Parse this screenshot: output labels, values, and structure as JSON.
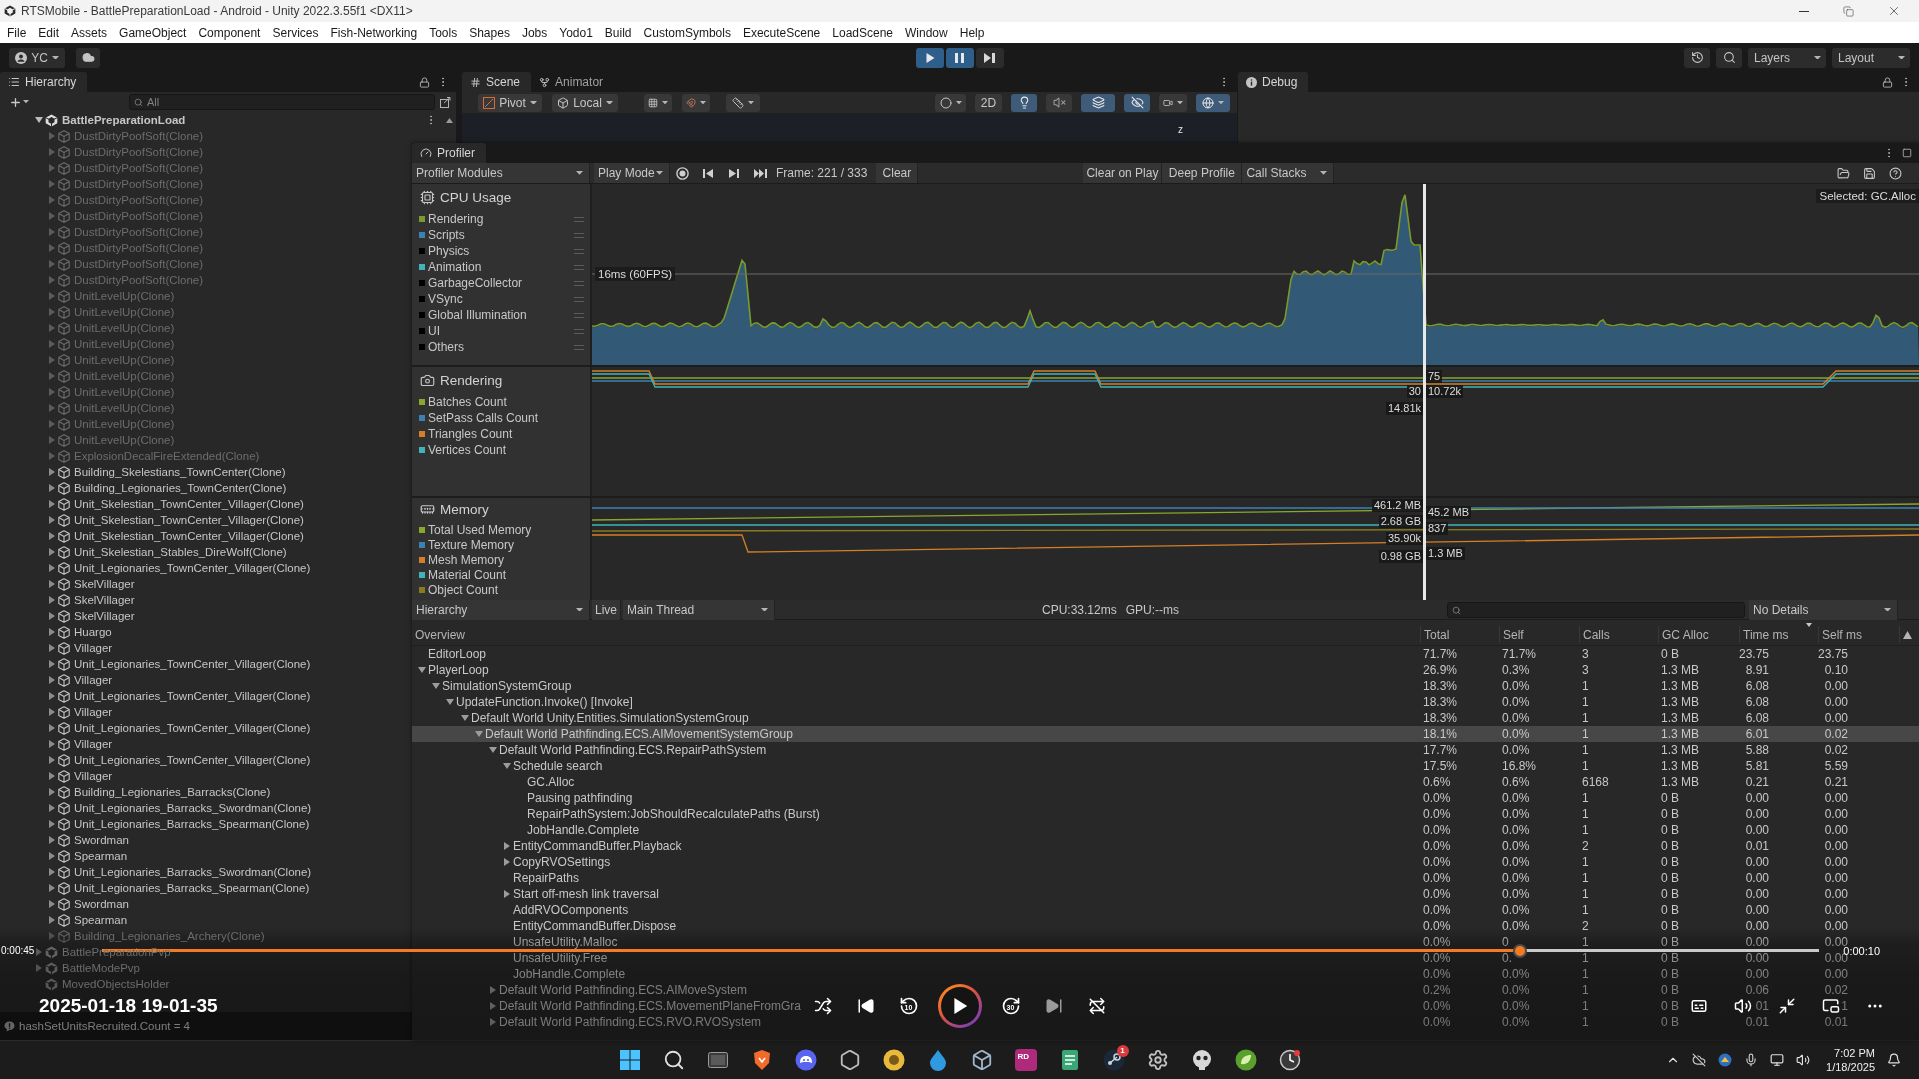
{
  "window": {
    "title": "RTSMobile - BattlePreparationLoad - Android - Unity 2022.3.55f1 <DX11>"
  },
  "menu": [
    "File",
    "Edit",
    "Assets",
    "GameObject",
    "Component",
    "Services",
    "Fish-Networking",
    "Tools",
    "Shapes",
    "Jobs",
    "Yodo1",
    "Build",
    "CustomSymbols",
    "ExecuteScene",
    "LoadScene",
    "Window",
    "Help"
  ],
  "toolbar": {
    "account": "YC",
    "play_controls": [
      {
        "kind": "play",
        "on": true
      },
      {
        "kind": "pause",
        "on": true
      },
      {
        "kind": "step",
        "on": false
      }
    ],
    "layers": "Layers",
    "layout": "Layout"
  },
  "hierarchy": {
    "tab": "Hierarchy",
    "search": {
      "placeholder": "All"
    },
    "scenes": [
      {
        "name": "BattlePreparationLoad",
        "loaded": true,
        "expanded": true,
        "children": [
          {
            "name": "DustDirtyPoofSoft(Clone)",
            "active": false,
            "expanded": false
          },
          {
            "name": "DustDirtyPoofSoft(Clone)",
            "active": false,
            "expanded": false
          },
          {
            "name": "DustDirtyPoofSoft(Clone)",
            "active": false,
            "expanded": false
          },
          {
            "name": "DustDirtyPoofSoft(Clone)",
            "active": false,
            "expanded": false
          },
          {
            "name": "DustDirtyPoofSoft(Clone)",
            "active": false,
            "expanded": false
          },
          {
            "name": "DustDirtyPoofSoft(Clone)",
            "active": false,
            "expanded": false
          },
          {
            "name": "DustDirtyPoofSoft(Clone)",
            "active": false,
            "expanded": false
          },
          {
            "name": "DustDirtyPoofSoft(Clone)",
            "active": false,
            "expanded": false
          },
          {
            "name": "DustDirtyPoofSoft(Clone)",
            "active": false,
            "expanded": false
          },
          {
            "name": "DustDirtyPoofSoft(Clone)",
            "active": false,
            "expanded": false
          },
          {
            "name": "UnitLevelUp(Clone)",
            "active": false,
            "expanded": false
          },
          {
            "name": "UnitLevelUp(Clone)",
            "active": false,
            "expanded": false
          },
          {
            "name": "UnitLevelUp(Clone)",
            "active": false,
            "expanded": false
          },
          {
            "name": "UnitLevelUp(Clone)",
            "active": false,
            "expanded": false
          },
          {
            "name": "UnitLevelUp(Clone)",
            "active": false,
            "expanded": false
          },
          {
            "name": "UnitLevelUp(Clone)",
            "active": false,
            "expanded": false
          },
          {
            "name": "UnitLevelUp(Clone)",
            "active": false,
            "expanded": false
          },
          {
            "name": "UnitLevelUp(Clone)",
            "active": false,
            "expanded": false
          },
          {
            "name": "UnitLevelUp(Clone)",
            "active": false,
            "expanded": false
          },
          {
            "name": "UnitLevelUp(Clone)",
            "active": false,
            "expanded": false
          },
          {
            "name": "ExplosionDecalFireExtended(Clone)",
            "active": false,
            "expanded": false
          },
          {
            "name": "Building_Skelestians_TownCenter(Clone)",
            "active": true,
            "expanded": false
          },
          {
            "name": "Building_Legionaries_TownCenter(Clone)",
            "active": true,
            "expanded": false
          },
          {
            "name": "Unit_Skelestian_TownCenter_Villager(Clone)",
            "active": true,
            "expanded": false
          },
          {
            "name": "Unit_Skelestian_TownCenter_Villager(Clone)",
            "active": true,
            "expanded": false
          },
          {
            "name": "Unit_Skelestian_TownCenter_Villager(Clone)",
            "active": true,
            "expanded": false
          },
          {
            "name": "Unit_Skelestian_Stables_DireWolf(Clone)",
            "active": true,
            "expanded": false
          },
          {
            "name": "Unit_Legionaries_TownCenter_Villager(Clone)",
            "active": true,
            "expanded": false
          },
          {
            "name": "SkelVillager",
            "active": true,
            "expanded": false
          },
          {
            "name": "SkelVillager",
            "active": true,
            "expanded": false
          },
          {
            "name": "SkelVillager",
            "active": true,
            "expanded": false
          },
          {
            "name": "Huargo",
            "active": true,
            "expanded": false
          },
          {
            "name": "Villager",
            "active": true,
            "expanded": false
          },
          {
            "name": "Unit_Legionaries_TownCenter_Villager(Clone)",
            "active": true,
            "expanded": false
          },
          {
            "name": "Villager",
            "active": true,
            "expanded": false
          },
          {
            "name": "Unit_Legionaries_TownCenter_Villager(Clone)",
            "active": true,
            "expanded": false
          },
          {
            "name": "Villager",
            "active": true,
            "expanded": false
          },
          {
            "name": "Unit_Legionaries_TownCenter_Villager(Clone)",
            "active": true,
            "expanded": false
          },
          {
            "name": "Villager",
            "active": true,
            "expanded": false
          },
          {
            "name": "Unit_Legionaries_TownCenter_Villager(Clone)",
            "active": true,
            "expanded": false
          },
          {
            "name": "Villager",
            "active": true,
            "expanded": false
          },
          {
            "name": "Building_Legionaries_Barracks(Clone)",
            "active": true,
            "expanded": false
          },
          {
            "name": "Unit_Legionaries_Barracks_Swordman(Clone)",
            "active": true,
            "expanded": false
          },
          {
            "name": "Unit_Legionaries_Barracks_Spearman(Clone)",
            "active": true,
            "expanded": false
          },
          {
            "name": "Swordman",
            "active": true,
            "expanded": false
          },
          {
            "name": "Spearman",
            "active": true,
            "expanded": false
          },
          {
            "name": "Unit_Legionaries_Barracks_Swordman(Clone)",
            "active": true,
            "expanded": false
          },
          {
            "name": "Unit_Legionaries_Barracks_Spearman(Clone)",
            "active": true,
            "expanded": false
          },
          {
            "name": "Swordman",
            "active": true,
            "expanded": false
          },
          {
            "name": "Spearman",
            "active": true,
            "expanded": false
          },
          {
            "name": "Building_Legionaries_Archery(Clone)",
            "active": false,
            "expanded": false
          }
        ]
      },
      {
        "name": "BattlePreparationPvp",
        "loaded": false,
        "expanded": false
      },
      {
        "name": "BattleModePvp",
        "loaded": false,
        "expanded": false
      },
      {
        "name": "MovedObjectsHolder",
        "loaded": false
      }
    ]
  },
  "scene_panel": {
    "tabs": [
      {
        "label": "Scene",
        "selected": true
      },
      {
        "label": "Animator",
        "selected": false
      }
    ],
    "pivot": "Pivot",
    "space": "Local",
    "toggle_2d": {
      "label": "2D",
      "on": false
    },
    "toggles": [
      {
        "kind": "lighting",
        "on": true
      },
      {
        "kind": "audio",
        "on": false
      },
      {
        "kind": "effects",
        "on": true
      },
      {
        "kind": "visibility",
        "on": true
      }
    ],
    "gizmo_axis": "z"
  },
  "debug_panel": {
    "tab": "Debug"
  },
  "profiler": {
    "tab": "Profiler",
    "toolbar": {
      "modules": "Profiler Modules",
      "play_mode": "Play Mode",
      "recording": false,
      "frame": "Frame: 221 / 333",
      "clear": "Clear",
      "clear_on_play": {
        "label": "Clear on Play",
        "on": false
      },
      "deep_profile": {
        "label": "Deep Profile",
        "on": false
      },
      "call_stacks": "Call Stacks"
    },
    "selected_sample": "Selected: GC.Alloc",
    "modules": [
      {
        "kind": "cpu",
        "title": "CPU Usage",
        "target_line": "16ms (60FPS)",
        "legend": [
          {
            "label": "Rendering",
            "color": "#7a9a2e"
          },
          {
            "label": "Scripts",
            "color": "#3b82b4"
          },
          {
            "label": "Physics",
            "color": "#000000"
          },
          {
            "label": "Animation",
            "color": "#3eb4b9"
          },
          {
            "label": "GarbageCollector",
            "color": "#000000"
          },
          {
            "label": "VSync",
            "color": "#000000"
          },
          {
            "label": "Global Illumination",
            "color": "#000000"
          },
          {
            "label": "UI",
            "color": "#000000"
          },
          {
            "label": "Others",
            "color": "#000000"
          }
        ]
      },
      {
        "kind": "rendering",
        "title": "Rendering",
        "readouts": [
          "75",
          "30",
          "10.72k",
          "14.81k"
        ],
        "legend": [
          {
            "label": "Batches Count",
            "color": "#8aa62d"
          },
          {
            "label": "SetPass Calls Count",
            "color": "#3b82b4"
          },
          {
            "label": "Triangles Count",
            "color": "#d47f25"
          },
          {
            "label": "Vertices Count",
            "color": "#3eb4b9"
          }
        ]
      },
      {
        "kind": "memory",
        "title": "Memory",
        "readouts": [
          "461.2 MB",
          "45.2 MB",
          "2.68 GB",
          "837",
          "35.90k",
          "0.98 GB",
          "1.3 MB"
        ],
        "legend": [
          {
            "label": "Total Used Memory",
            "color": "#8aa62d"
          },
          {
            "label": "Texture Memory",
            "color": "#3b82b4"
          },
          {
            "label": "Mesh Memory",
            "color": "#d47f25"
          },
          {
            "label": "Material Count",
            "color": "#3eb4b9"
          },
          {
            "label": "Object Count",
            "color": "#8a7a1e"
          }
        ]
      }
    ],
    "details": {
      "view": "Hierarchy",
      "live": {
        "label": "Live",
        "on": false
      },
      "thread": "Main Thread",
      "cpu_time": "CPU:33.12ms",
      "gpu_time": "GPU:--ms",
      "detail_view": "No Details"
    },
    "table": {
      "columns": [
        {
          "label": "Overview",
          "sorted": false
        },
        {
          "label": "Total",
          "sorted": false
        },
        {
          "label": "Self",
          "sorted": false
        },
        {
          "label": "Calls",
          "sorted": false
        },
        {
          "label": "GC Alloc",
          "sorted": false
        },
        {
          "label": "Time ms",
          "sorted": true
        },
        {
          "label": "Self ms",
          "sorted": false
        }
      ],
      "rows": [
        {
          "cells": [
            "EditorLoop",
            "71.7%",
            "71.7%",
            "3",
            "0 B",
            "23.75",
            "23.75"
          ],
          "selected": false
        },
        {
          "cells": [
            "PlayerLoop",
            "26.9%",
            "0.3%",
            "3",
            "1.3 MB",
            "8.91",
            "0.10"
          ],
          "selected": false,
          "expanded": true,
          "children": [
            {
              "cells": [
                "SimulationSystemGroup",
                "18.3%",
                "0.0%",
                "1",
                "1.3 MB",
                "6.08",
                "0.00"
              ],
              "selected": false,
              "expanded": true,
              "children": [
                {
                  "cells": [
                    "UpdateFunction.Invoke() [Invoke]",
                    "18.3%",
                    "0.0%",
                    "1",
                    "1.3 MB",
                    "6.08",
                    "0.00"
                  ],
                  "selected": false,
                  "expanded": true,
                  "children": [
                    {
                      "cells": [
                        "Default World Unity.Entities.SimulationSystemGroup",
                        "18.3%",
                        "0.0%",
                        "1",
                        "1.3 MB",
                        "6.08",
                        "0.00"
                      ],
                      "selected": false,
                      "expanded": true,
                      "children": [
                        {
                          "cells": [
                            "Default World Pathfinding.ECS.AIMovementSystemGroup",
                            "18.1%",
                            "0.0%",
                            "1",
                            "1.3 MB",
                            "6.01",
                            "0.02"
                          ],
                          "selected": true,
                          "expanded": true,
                          "children": [
                            {
                              "cells": [
                                "Default World Pathfinding.ECS.RepairPathSystem",
                                "17.7%",
                                "0.0%",
                                "1",
                                "1.3 MB",
                                "5.88",
                                "0.02"
                              ],
                              "selected": false,
                              "expanded": true,
                              "children": [
                                {
                                  "cells": [
                                    "Schedule search",
                                    "17.5%",
                                    "16.8%",
                                    "1",
                                    "1.3 MB",
                                    "5.81",
                                    "5.59"
                                  ],
                                  "selected": false,
                                  "expanded": true,
                                  "children": [
                                    {
                                      "cells": [
                                        "GC.Alloc",
                                        "0.6%",
                                        "0.6%",
                                        "6168",
                                        "1.3 MB",
                                        "0.21",
                                        "0.21"
                                      ],
                                      "selected": false
                                    },
                                    {
                                      "cells": [
                                        "Pausing pathfinding",
                                        "0.0%",
                                        "0.0%",
                                        "1",
                                        "0 B",
                                        "0.00",
                                        "0.00"
                                      ],
                                      "selected": false
                                    },
                                    {
                                      "cells": [
                                        "RepairPathSystem:JobShouldRecalculatePaths (Burst)",
                                        "0.0%",
                                        "0.0%",
                                        "1",
                                        "0 B",
                                        "0.00",
                                        "0.00"
                                      ],
                                      "selected": false
                                    },
                                    {
                                      "cells": [
                                        "JobHandle.Complete",
                                        "0.0%",
                                        "0.0%",
                                        "1",
                                        "0 B",
                                        "0.00",
                                        "0.00"
                                      ],
                                      "selected": false
                                    }
                                  ]
                                },
                                {
                                  "cells": [
                                    "EntityCommandBuffer.Playback",
                                    "0.0%",
                                    "0.0%",
                                    "2",
                                    "0 B",
                                    "0.01",
                                    "0.00"
                                  ],
                                  "selected": false,
                                  "expanded": false
                                },
                                {
                                  "cells": [
                                    "CopyRVOSettings",
                                    "0.0%",
                                    "0.0%",
                                    "1",
                                    "0 B",
                                    "0.00",
                                    "0.00"
                                  ],
                                  "selected": false,
                                  "expanded": false
                                },
                                {
                                  "cells": [
                                    "RepairPaths",
                                    "0.0%",
                                    "0.0%",
                                    "1",
                                    "0 B",
                                    "0.00",
                                    "0.00"
                                  ],
                                  "selected": false
                                },
                                {
                                  "cells": [
                                    "Start off-mesh link traversal",
                                    "0.0%",
                                    "0.0%",
                                    "1",
                                    "0 B",
                                    "0.00",
                                    "0.00"
                                  ],
                                  "selected": false,
                                  "expanded": false
                                },
                                {
                                  "cells": [
                                    "AddRVOComponents",
                                    "0.0%",
                                    "0.0%",
                                    "1",
                                    "0 B",
                                    "0.00",
                                    "0.00"
                                  ],
                                  "selected": false
                                },
                                {
                                  "cells": [
                                    "EntityCommandBuffer.Dispose",
                                    "0.0%",
                                    "0.0%",
                                    "2",
                                    "0 B",
                                    "0.00",
                                    "0.00"
                                  ],
                                  "selected": false
                                },
                                {
                                  "cells": [
                                    "UnsafeUtility.Malloc",
                                    "0.0%",
                                    "0",
                                    "1",
                                    "0 B",
                                    "0.00",
                                    "0.00"
                                  ],
                                  "selected": false
                                },
                                {
                                  "cells": [
                                    "UnsafeUtility.Free",
                                    "0.0%",
                                    "0.",
                                    "1",
                                    "0 B",
                                    "0.00",
                                    "0.00"
                                  ],
                                  "selected": false
                                },
                                {
                                  "cells": [
                                    "JobHandle.Complete",
                                    "0.0%",
                                    "0.0%",
                                    "1",
                                    "0 B",
                                    "0.00",
                                    "0.00"
                                  ],
                                  "selected": false
                                }
                              ]
                            },
                            {
                              "cells": [
                                "Default World Pathfinding.ECS.AIMoveSystem",
                                "0.2%",
                                "0.0%",
                                "1",
                                "0 B",
                                "0.06",
                                "0.02"
                              ],
                              "selected": false,
                              "expanded": false
                            },
                            {
                              "cells": [
                                "Default World Pathfinding.ECS.MovementPlaneFromGra",
                                "0.0%",
                                "0.0%",
                                "1",
                                "0 B",
                                "01",
                                "1"
                              ],
                              "selected": false,
                              "expanded": false
                            },
                            {
                              "cells": [
                                "Default World Pathfinding.ECS.RVO.RVOSystem",
                                "0.0%",
                                "0.0%",
                                "1",
                                "0 B",
                                "0.01",
                                "0.01"
                              ],
                              "selected": false,
                              "expanded": false
                            }
                          ]
                        }
                      ]
                    }
                  ]
                }
              ]
            }
          ]
        }
      ]
    }
  },
  "player": {
    "elapsed": "0:00:45",
    "remaining": "0:00:10",
    "level": 0.826,
    "title": "2025-01-18 19-01-35",
    "rewind": "10",
    "forward": "30"
  },
  "status": {
    "message": "hashSetUnitsRecruited.Count = 4"
  },
  "taskbar": {
    "tile_text": "RD",
    "badge": "1",
    "time": "7:02 PM",
    "date": "1/18/2025"
  }
}
